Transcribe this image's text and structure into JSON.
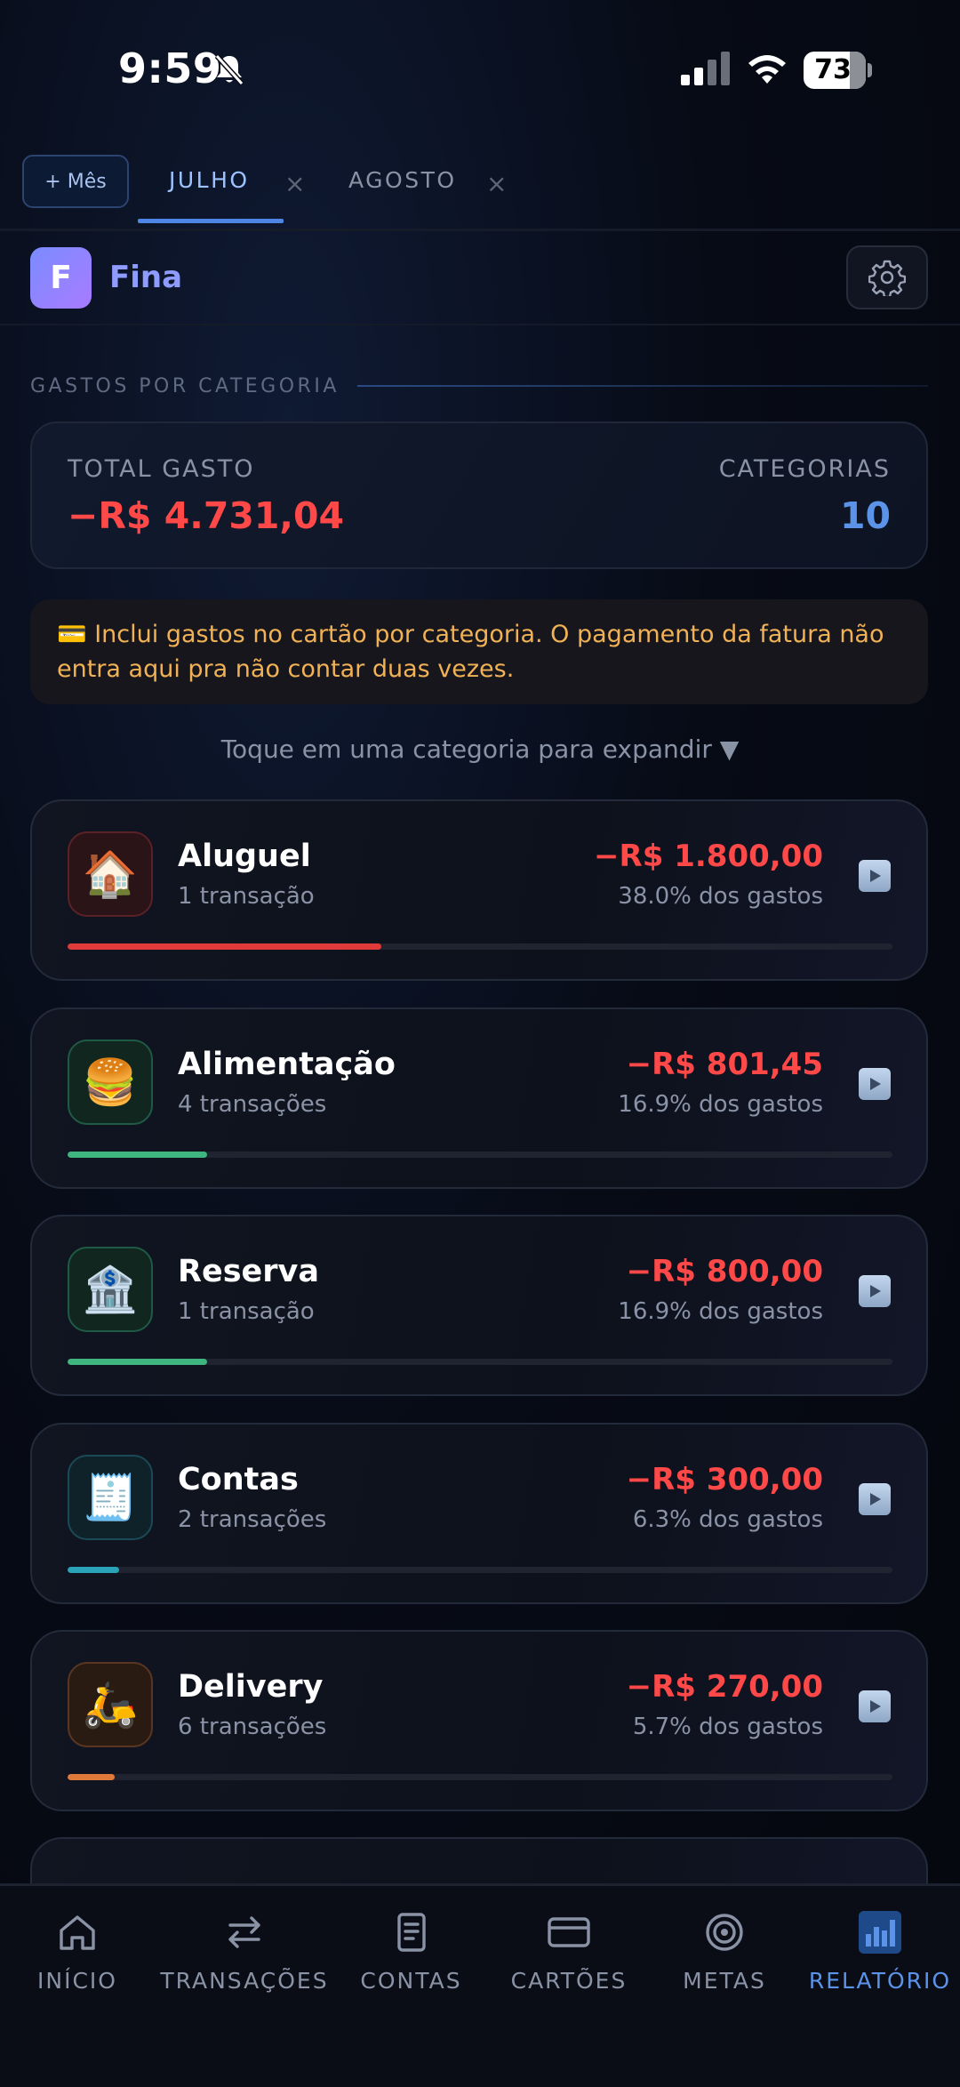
{
  "status_bar": {
    "time": "9:59",
    "battery": "73"
  },
  "tabs": {
    "add_label": "+ Mês",
    "months": [
      {
        "label": "JULHO",
        "close": "×",
        "active": true
      },
      {
        "label": "AGOSTO",
        "close": "×",
        "active": false
      }
    ]
  },
  "header": {
    "logo_letter": "F",
    "app_name": "Fina"
  },
  "section": {
    "label": "GASTOS POR CATEGORIA"
  },
  "summary": {
    "total_label": "TOTAL GASTO",
    "total_value": "−R$ 4.731,04",
    "categories_label": "CATEGORIAS",
    "categories_value": "10"
  },
  "info_note": "💳 Inclui gastos no cartão por categoria. O pagamento da fatura não entra aqui pra não contar duas vezes.",
  "hint": "Toque em uma categoria para expandir ▼",
  "categories": [
    {
      "name": "Aluguel",
      "count": "1 transação",
      "amount": "−R$ 1.800,00",
      "percent_text": "38.0% dos gastos",
      "share": 0.38,
      "icon": "🏠",
      "icon_name": "house-icon",
      "color": "#e03a3a",
      "icon_border": "#5a2226",
      "icon_bg": "#2a1418"
    },
    {
      "name": "Alimentação",
      "count": "4 transações",
      "amount": "−R$ 801,45",
      "percent_text": "16.9% dos gastos",
      "share": 0.169,
      "icon": "🍔",
      "icon_name": "burger-icon",
      "color": "#3fb57f",
      "icon_border": "#1f5a44",
      "icon_bg": "#10261f"
    },
    {
      "name": "Reserva",
      "count": "1 transação",
      "amount": "−R$ 800,00",
      "percent_text": "16.9% dos gastos",
      "share": 0.169,
      "icon": "🏦",
      "icon_name": "bank-icon",
      "color": "#3fb57f",
      "icon_border": "#1f5a44",
      "icon_bg": "#10261f"
    },
    {
      "name": "Contas",
      "count": "2 transações",
      "amount": "−R$ 300,00",
      "percent_text": "6.3% dos gastos",
      "share": 0.063,
      "icon": "🧾",
      "icon_name": "receipt-icon",
      "color": "#2aa3b8",
      "icon_border": "#1b4a57",
      "icon_bg": "#0f2129"
    },
    {
      "name": "Delivery",
      "count": "6 transações",
      "amount": "−R$ 270,00",
      "percent_text": "5.7% dos gastos",
      "share": 0.057,
      "icon": "🛵",
      "icon_name": "scooter-icon",
      "color": "#e07a3a",
      "icon_border": "#5a3622",
      "icon_bg": "#2a1b12"
    }
  ],
  "nav": [
    {
      "label": "INÍCIO",
      "icon": "home-icon"
    },
    {
      "label": "TRANSAÇÕES",
      "icon": "transfer-icon"
    },
    {
      "label": "CONTAS",
      "icon": "document-icon"
    },
    {
      "label": "CARTÕES",
      "icon": "card-icon"
    },
    {
      "label": "METAS",
      "icon": "target-icon"
    },
    {
      "label": "RELATÓRIO",
      "icon": "bar-chart-icon",
      "active": true
    }
  ],
  "colors": {
    "accent": "#5a93e8",
    "negative": "#ff4848",
    "warning": "#f1b256",
    "brand": "#8e9bff"
  }
}
